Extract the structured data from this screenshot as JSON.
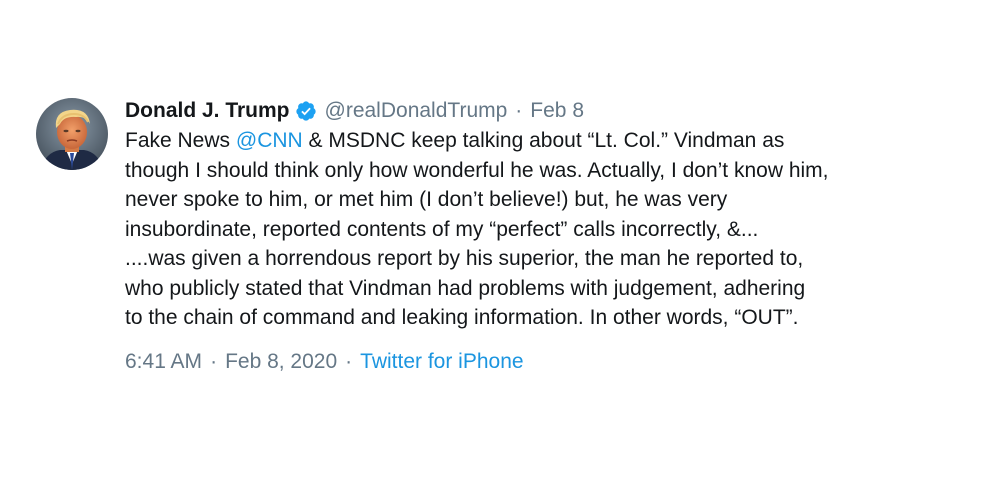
{
  "author": {
    "display_name": "Donald J. Trump",
    "handle": "@realDonaldTrump",
    "verified": true,
    "avatar_icon": "profile-photo-avatar"
  },
  "header": {
    "separator": "·",
    "date": "Feb 8"
  },
  "tweet": {
    "lines": [
      {
        "before": "Fake News ",
        "mention": "@CNN",
        "after": " & MSDNC keep talking about “Lt. Col.” Vindman as"
      },
      {
        "text": "though I should think only how wonderful he was. Actually, I don’t know him,"
      },
      {
        "text": "never spoke to him, or met him (I don’t believe!) but, he was very"
      },
      {
        "text": "insubordinate, reported contents of my “perfect” calls incorrectly, &..."
      },
      {
        "text": "....was given a horrendous report by his superior, the man he reported to,"
      },
      {
        "text": "who publicly stated that Vindman had problems with judgement, adhering"
      },
      {
        "text": "to the chain of command and leaking information. In other words, “OUT”."
      }
    ]
  },
  "meta": {
    "time": "6:41 AM",
    "separator": "·",
    "full_date": "Feb 8, 2020",
    "separator2": "·",
    "source": "Twitter for iPhone"
  },
  "colors": {
    "text": "#14171a",
    "secondary": "#657786",
    "link": "#1b95e0",
    "verified_badge": "#1da1f2"
  }
}
